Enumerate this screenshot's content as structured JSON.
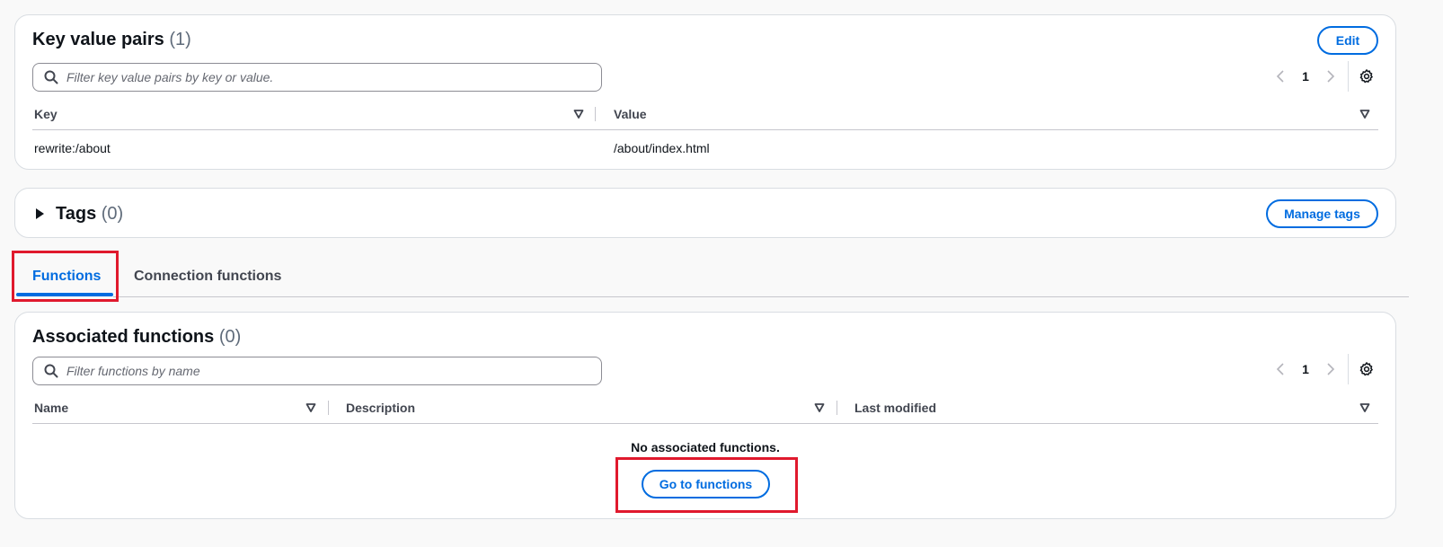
{
  "kv_panel": {
    "title": "Key value pairs",
    "count": "(1)",
    "edit_label": "Edit",
    "search_placeholder": "Filter key value pairs by key or value.",
    "page": "1",
    "columns": [
      "Key",
      "Value"
    ],
    "rows": [
      {
        "key": "rewrite:/about",
        "value": "/about/index.html"
      }
    ]
  },
  "tags_panel": {
    "title": "Tags",
    "count": "(0)",
    "manage_label": "Manage tags"
  },
  "tabs": [
    {
      "label": "Functions",
      "active": true
    },
    {
      "label": "Connection functions",
      "active": false
    }
  ],
  "functions_panel": {
    "title": "Associated functions",
    "count": "(0)",
    "search_placeholder": "Filter functions by name",
    "page": "1",
    "columns": [
      "Name",
      "Description",
      "Last modified"
    ],
    "empty_text": "No associated functions.",
    "go_label": "Go to functions"
  },
  "colors": {
    "accent": "#006ce0",
    "highlight": "#e0192d",
    "border": "#d9dde2"
  }
}
